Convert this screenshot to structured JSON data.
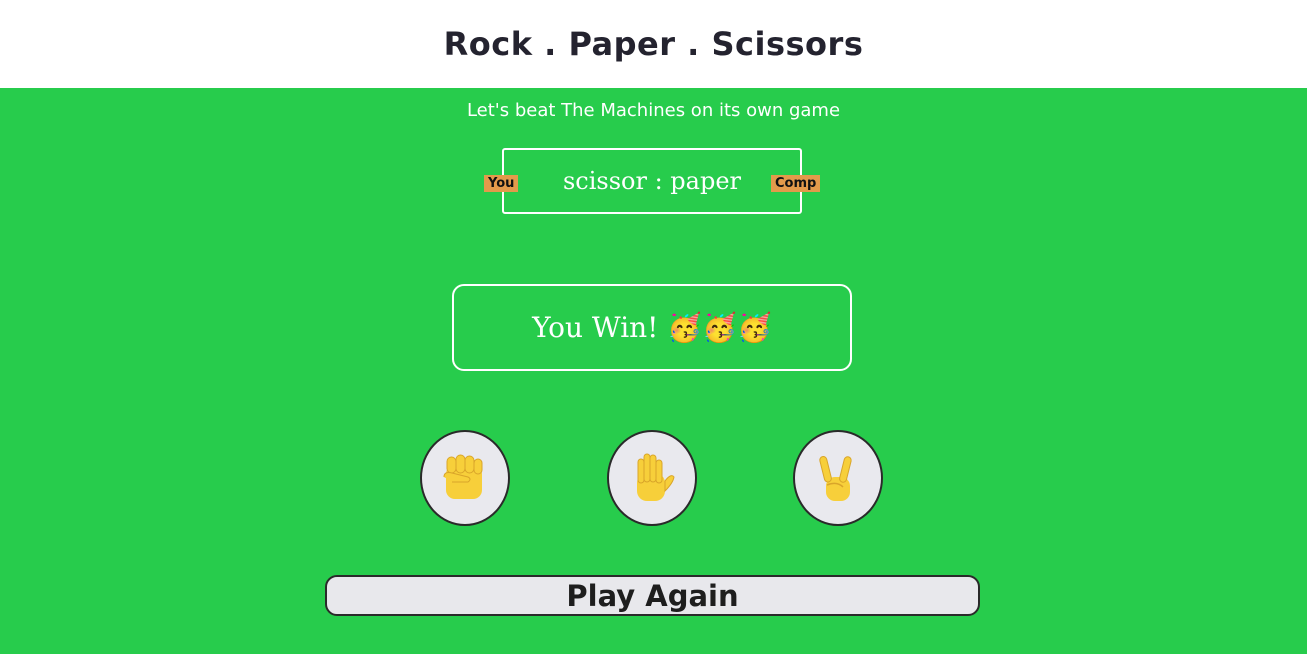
{
  "header": {
    "title": "Rock . Paper . Scissors"
  },
  "subtitle": "Let's beat The Machines on its own game",
  "score": {
    "you_label": "You",
    "comp_label": "Comp",
    "text": "scissor : paper"
  },
  "result": {
    "text": "You Win! 🥳🥳🥳"
  },
  "choices": [
    {
      "name": "rock",
      "icon": "raised-fist-icon"
    },
    {
      "name": "paper",
      "icon": "raised-hand-icon"
    },
    {
      "name": "scissors",
      "icon": "victory-hand-icon"
    }
  ],
  "play_again_label": "Play Again",
  "colors": {
    "background": "#27cc4c",
    "header_bg": "#ffffff",
    "badge": "#e39a4b",
    "button_bg": "#e8e8ec"
  }
}
